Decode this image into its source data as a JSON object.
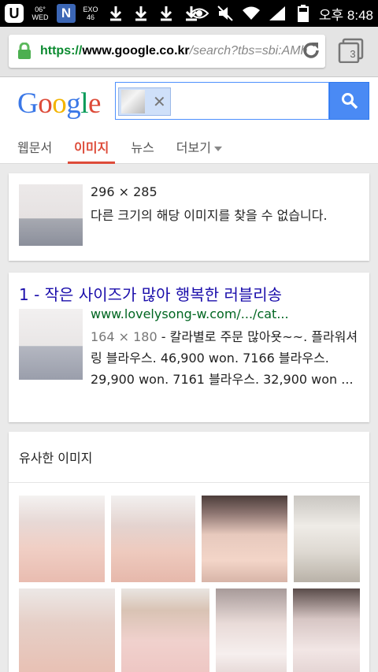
{
  "status_bar": {
    "weather": [
      "06°",
      "WED"
    ],
    "exo": [
      "EXO",
      "46"
    ],
    "time": "오후 8:48",
    "icons": [
      "u-app-icon",
      "weather-icon",
      "n-app-icon",
      "exo-icon",
      "download-icon",
      "download-icon",
      "download-icon",
      "download-icon",
      "eye-icon",
      "mute-icon",
      "wifi-icon",
      "signal-icon",
      "battery-icon"
    ]
  },
  "browser": {
    "url_scheme": "https://",
    "url_host": "www.google.co.kr",
    "url_path": "/search?tbs=sbi:AMh",
    "tab_count": "3"
  },
  "google": {
    "logo": "Google",
    "logo_colors": [
      "#3b78e7",
      "#dd4b39",
      "#f3b400",
      "#3b78e7",
      "#009a57",
      "#dd4b39"
    ],
    "tabs": [
      {
        "label": "웹문서"
      },
      {
        "label": "이미지",
        "active": true
      },
      {
        "label": "뉴스"
      },
      {
        "label": "더보기"
      }
    ]
  },
  "query_card": {
    "dimensions": "296 × 285",
    "message": "다른 크기의 해당 이미지를 찾을 수 없습니다."
  },
  "result": {
    "title": "1 - 작은 사이즈가 많아 행복한 러블리송",
    "url": "www.lovelysong-w.com/.../cat...",
    "dim": "164 × 180",
    "snippet": " - 칼라별로 주문 많아욧~~. 플라워셔링 블라우스. 46,900 won. 7166 블라우스. 29,900 won. 7161 블라우스. 32,900 won ..."
  },
  "similar": {
    "title": "유사한 이미지"
  }
}
